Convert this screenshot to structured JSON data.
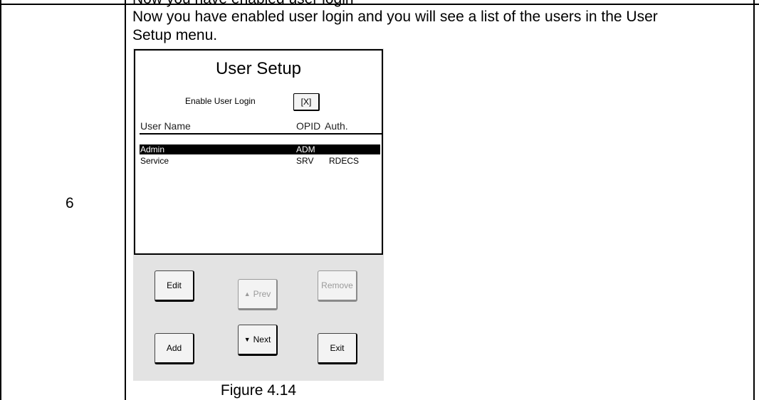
{
  "top_cut_text": "Now you have enabled user login",
  "step": {
    "number": "6",
    "instruction": "Now you have enabled user login and you will see a list of the users in the User Setup menu."
  },
  "device_screen": {
    "title": "User Setup",
    "enable_login_label": "Enable User Login",
    "enable_login_value": "[X]",
    "columns": {
      "name": "User Name",
      "opid": "OPID",
      "auth": "Auth."
    },
    "users": [
      {
        "name": "Admin",
        "opid": "ADM",
        "auth": "",
        "selected": true
      },
      {
        "name": "Service",
        "opid": "SRV",
        "auth": "RDECS",
        "selected": false
      }
    ]
  },
  "buttons": {
    "edit": "Edit",
    "prev": "Prev",
    "remove": "Remove",
    "add": "Add",
    "next": "Next",
    "exit": "Exit"
  },
  "icons": {
    "prev": "triangle-up-icon",
    "next": "triangle-down-icon"
  },
  "caption": "Figure 4.14"
}
